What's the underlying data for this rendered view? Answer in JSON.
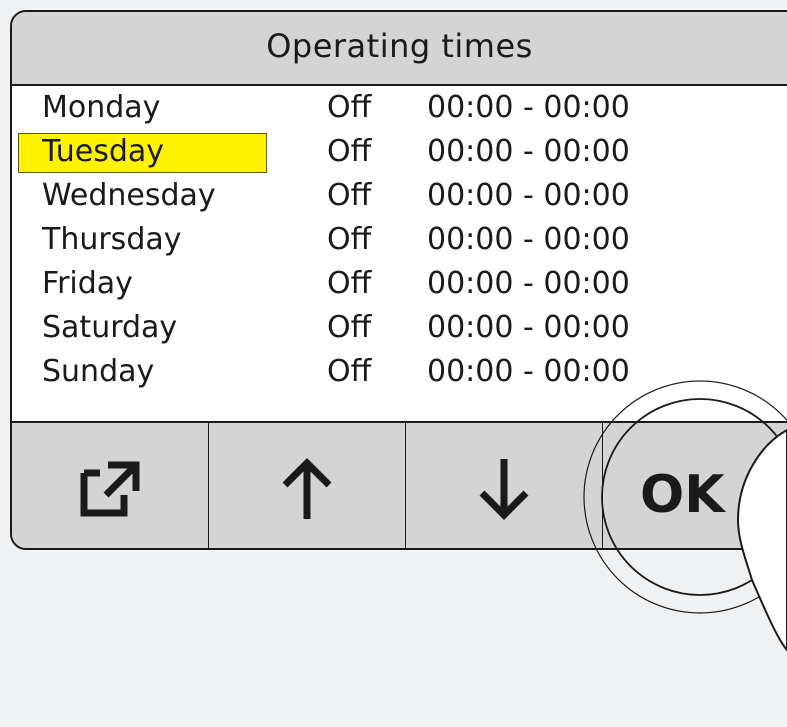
{
  "header": {
    "title": "Operating times"
  },
  "schedule": {
    "rows": [
      {
        "day": "Monday",
        "state": "Off",
        "time": "00:00 - 00:00",
        "selected": false
      },
      {
        "day": "Tuesday",
        "state": "Off",
        "time": "00:00 - 00:00",
        "selected": true
      },
      {
        "day": "Wednesday",
        "state": "Off",
        "time": "00:00 - 00:00",
        "selected": false
      },
      {
        "day": "Thursday",
        "state": "Off",
        "time": "00:00 - 00:00",
        "selected": false
      },
      {
        "day": "Friday",
        "state": "Off",
        "time": "00:00 - 00:00",
        "selected": false
      },
      {
        "day": "Saturday",
        "state": "Off",
        "time": "00:00 - 00:00",
        "selected": false
      },
      {
        "day": "Sunday",
        "state": "Off",
        "time": "00:00 - 00:00",
        "selected": false
      }
    ]
  },
  "toolbar": {
    "edit_icon": "edit-open-icon",
    "up_icon": "arrow-up-icon",
    "down_icon": "arrow-down-icon",
    "ok_label": "OK"
  },
  "colors": {
    "selection": "#fff200",
    "bar": "#d4d4d4",
    "background": "#f0f1f3"
  }
}
